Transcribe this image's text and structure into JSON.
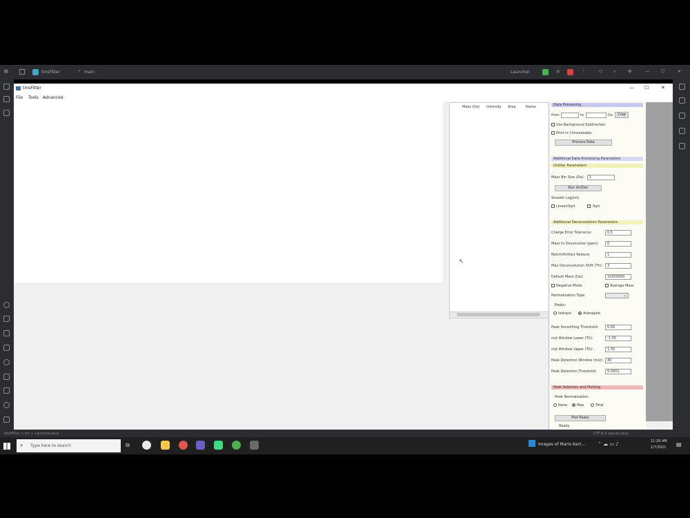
{
  "ide": {
    "project_name": "tmsFitter",
    "branch": "main",
    "run_config": "Launcher",
    "status_left": "tmsFitter > src > Launcher.java",
    "status_right": "UTF-8  4 spaces  Java"
  },
  "app": {
    "title": "tmsFitter",
    "menu": [
      "File",
      "Tools",
      "Advanced"
    ],
    "window_controls": [
      "—",
      "☐",
      "✕"
    ]
  },
  "list": {
    "columns": [
      "Mass (Da)",
      "Intensity",
      "Area",
      "Name"
    ]
  },
  "panel": {
    "data_processing": {
      "header": "Data Processing",
      "start_label": "from",
      "to_label": "to",
      "unit": "Da",
      "unit_button": "Crop",
      "checkbox1": "Use Background Subtraction",
      "checkbox2": "Print in Chromatable",
      "process_button": "Process Data"
    },
    "additional_header": "Additional Data Processing Parameters",
    "unidec": {
      "header": "UniDec Parameters",
      "mass_bin_label": "Mass Bin Size (Da):",
      "mass_bin_value": "1",
      "run_button": "Run UniDec",
      "smooth_label": "Smooth Log(Int)",
      "opt1": "Linear/Sqrt",
      "opt2": "Sqrt"
    },
    "deconv": {
      "header": "Additional Deconvolution Parameters",
      "fields": [
        {
          "label": "Charge Error Tolerance:",
          "value": "0.5"
        },
        {
          "label": "Mass to Deconvolve (ppm):",
          "value": "0"
        },
        {
          "label": "Notch/Artifact Reduce:",
          "value": "1"
        },
        {
          "label": "Max Deconvolution Shift (Th):",
          "value": "3"
        },
        {
          "label": "Default Mass (Da):",
          "value": "10000000"
        }
      ],
      "negative_mode": "Negative Mode",
      "average_mass": "Average Mass",
      "norm_type_label": "Normalization Type:",
      "peaks_label": "Peaks:",
      "peaks_opt1": "Isotopic",
      "peaks_opt2": "Averagine",
      "fields2": [
        {
          "label": "Peak Smoothing Threshold:",
          "value": "0.05"
        },
        {
          "label": "m/z Window Lower (Th):",
          "value": "-1.05"
        },
        {
          "label": "m/z Window Upper (Th):",
          "value": "1.05"
        },
        {
          "label": "Peak Detection Window (m/z):",
          "value": "40"
        },
        {
          "label": "Peak Detection Threshold:",
          "value": "0.0001"
        }
      ]
    },
    "peak": {
      "header": "Peak Selection and Plotting",
      "norm_label": "Peak Normalization:",
      "opt1": "None",
      "opt2": "Max",
      "opt3": "Total"
    },
    "bottom_button": "Plot Peaks",
    "bottom_status": "Ready"
  },
  "taskbar": {
    "search_placeholder": "Type here to search",
    "notification": "Images of Mario Kart...",
    "time": "11:26 AM",
    "date": "1/7/2021"
  },
  "colors": {
    "ide_bg": "#2b2d30",
    "dp_header": "#c8c8f0",
    "unidec_header": "#f0f0b8",
    "peak_header": "#f0b8b8",
    "accent_green": "#4caf50",
    "accent_red": "#e04040"
  }
}
